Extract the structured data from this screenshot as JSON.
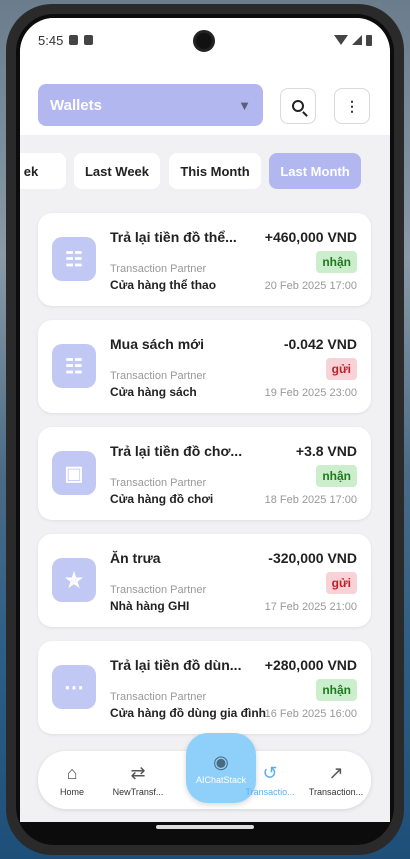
{
  "status_bar": {
    "time": "5:45"
  },
  "header": {
    "wallet_label": "Wallets",
    "chevron_icon": "chevron-down-icon",
    "search_icon": "search-icon",
    "more_icon": "more-vertical-icon"
  },
  "filters": [
    {
      "label": "ek"
    },
    {
      "label": "Last Week"
    },
    {
      "label": "This Month"
    },
    {
      "label": "Last Month",
      "selected": true
    }
  ],
  "transactions": [
    {
      "icon": "gamepad-icon",
      "title": "Trả lại tiền đồ thể...",
      "amount": "+460,000 VND",
      "type": "nhận",
      "partner_label": "Transaction Partner",
      "partner": "Cửa hàng thể thao",
      "date": "20 Feb 2025 17:00"
    },
    {
      "icon": "gamepad-icon",
      "title": "Mua sách mới",
      "amount": "-0.042 VND",
      "type": "gửi",
      "partner_label": "Transaction Partner",
      "partner": "Cửa hàng sách",
      "date": "19 Feb 2025 23:00"
    },
    {
      "icon": "cart-icon",
      "title": "Trả lại tiền đồ chơ...",
      "amount": "+3.8 VND",
      "type": "nhận",
      "partner_label": "Transaction Partner",
      "partner": "Cửa hàng đồ chơi",
      "date": "18 Feb 2025 17:00"
    },
    {
      "icon": "cutlery-icon",
      "title": "Ăn trưa",
      "amount": "-320,000 VND",
      "type": "gửi",
      "partner_label": "Transaction Partner",
      "partner": "Nhà hàng GHI",
      "date": "17 Feb 2025 21:00"
    },
    {
      "icon": "more-horizontal-icon",
      "title": "Trả lại tiền đồ dùn...",
      "amount": "+280,000 VND",
      "type": "nhận",
      "partner_label": "Transaction Partner",
      "partner": "Cửa hàng đồ dùng gia đình",
      "date": "16 Feb 2025 16:00"
    }
  ],
  "bottom_nav": {
    "items": [
      {
        "label": "Home",
        "icon": "home-icon"
      },
      {
        "label": "NewTransf...",
        "icon": "swap-icon"
      },
      {
        "label": "Transactio...",
        "icon": "history-icon",
        "active": true
      },
      {
        "label": "Transaction...",
        "icon": "chart-icon"
      }
    ],
    "fab": {
      "label": "AIChatStack",
      "icon": "chat-icon"
    }
  },
  "colors": {
    "accent": "#b2b8ef",
    "fab": "#8fd0fb",
    "active_nav": "#5aaef0",
    "received": "#1e7a1e",
    "sent": "#c0202a"
  }
}
